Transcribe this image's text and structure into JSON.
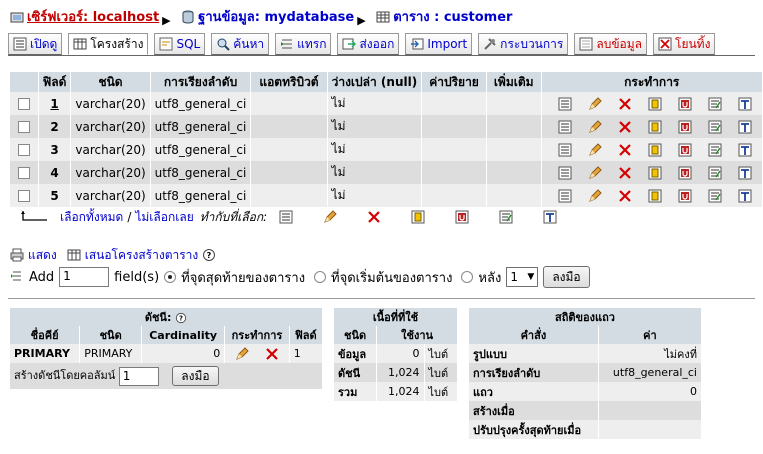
{
  "breadcrumb": {
    "server": "เซิร์ฟเวอร์: localhost",
    "database": "ฐานข้อมูล: mydatabase",
    "table": "ตาราง : customer"
  },
  "tabs": [
    {
      "label": "เปิดดู"
    },
    {
      "label": "โครงสร้าง"
    },
    {
      "label": "SQL"
    },
    {
      "label": "ค้นหา"
    },
    {
      "label": "แทรก"
    },
    {
      "label": "ส่งออก"
    },
    {
      "label": "Import"
    },
    {
      "label": "กระบวนการ"
    },
    {
      "label": "ลบข้อมูล"
    },
    {
      "label": "โยนทิ้ง"
    }
  ],
  "structure": {
    "headers": [
      "ฟิลด์",
      "ชนิด",
      "การเรียงลำดับ",
      "แอตทริบิวต์",
      "ว่างเปล่า (null)",
      "ค่าปริยาย",
      "เพิ่มเติม",
      "กระทำการ"
    ],
    "rows": [
      {
        "field": "1",
        "type": "varchar(20)",
        "collation": "utf8_general_ci",
        "attributes": "",
        "null": "ไม่",
        "default": "",
        "extra": ""
      },
      {
        "field": "2",
        "type": "varchar(20)",
        "collation": "utf8_general_ci",
        "attributes": "",
        "null": "ไม่",
        "default": "",
        "extra": ""
      },
      {
        "field": "3",
        "type": "varchar(20)",
        "collation": "utf8_general_ci",
        "attributes": "",
        "null": "ไม่",
        "default": "",
        "extra": ""
      },
      {
        "field": "4",
        "type": "varchar(20)",
        "collation": "utf8_general_ci",
        "attributes": "",
        "null": "ไม่",
        "default": "",
        "extra": ""
      },
      {
        "field": "5",
        "type": "varchar(20)",
        "collation": "utf8_general_ci",
        "attributes": "",
        "null": "ไม่",
        "default": "",
        "extra": ""
      }
    ]
  },
  "checkall": {
    "check_all": "เลือกทั้งหมด",
    "separator": "/",
    "uncheck_all": "ไม่เลือกเลย",
    "with_selected": "ทำกับที่เลือก:"
  },
  "print_row": {
    "print_view": "แสดง",
    "propose": "เสนอโครงสร้างตาราง"
  },
  "add_row": {
    "add_label": "Add",
    "count_value": "1",
    "fields_label": "field(s)",
    "opt_end": "ที่จุดสุดท้ายของตาราง",
    "opt_begin": "ที่จุดเริ่มต้นของตาราง",
    "opt_after": "หลัง",
    "after_value": "1",
    "go": "ลงมือ"
  },
  "indexes": {
    "title": "ดัชนี:",
    "headers": [
      "ชื่อคีย์",
      "ชนิด",
      "Cardinality",
      "กระทำการ",
      "ฟิลด์"
    ],
    "row": {
      "keyname": "PRIMARY",
      "type": "PRIMARY",
      "cardinality": "0",
      "field": "1"
    },
    "create_label": "สร้างดัชนีโดยคอลัมน์",
    "create_value": "1",
    "go": "ลงมือ"
  },
  "space_usage": {
    "title": "เนื้อที่ที่ใช้",
    "headers": [
      "ชนิด",
      "ใช้งาน"
    ],
    "rows": [
      {
        "type": "ข้อมูล",
        "value": "0",
        "unit": "ไบต์"
      },
      {
        "type": "ดัชนี",
        "value": "1,024",
        "unit": "ไบต์"
      },
      {
        "type": "รวม",
        "value": "1,024",
        "unit": "ไบต์"
      }
    ]
  },
  "row_stats": {
    "title": "สถิติของแถว",
    "headers": [
      "คำสั่ง",
      "ค่า"
    ],
    "rows": [
      {
        "label": "รูปแบบ",
        "value": "ไม่คงที่"
      },
      {
        "label": "การเรียงลำดับ",
        "value": "utf8_general_ci"
      },
      {
        "label": "แถว",
        "value": "0"
      },
      {
        "label": "สร้างเมื่อ",
        "value": ""
      },
      {
        "label": "ปรับปรุงครั้งสุดท้ายเมื่อ",
        "value": ""
      }
    ]
  },
  "colors": {
    "header_bg": "#d3dce3",
    "row_odd": "#eeeeee",
    "row_even": "#dddddd",
    "link": "#0000cc",
    "danger": "#cc0000"
  }
}
